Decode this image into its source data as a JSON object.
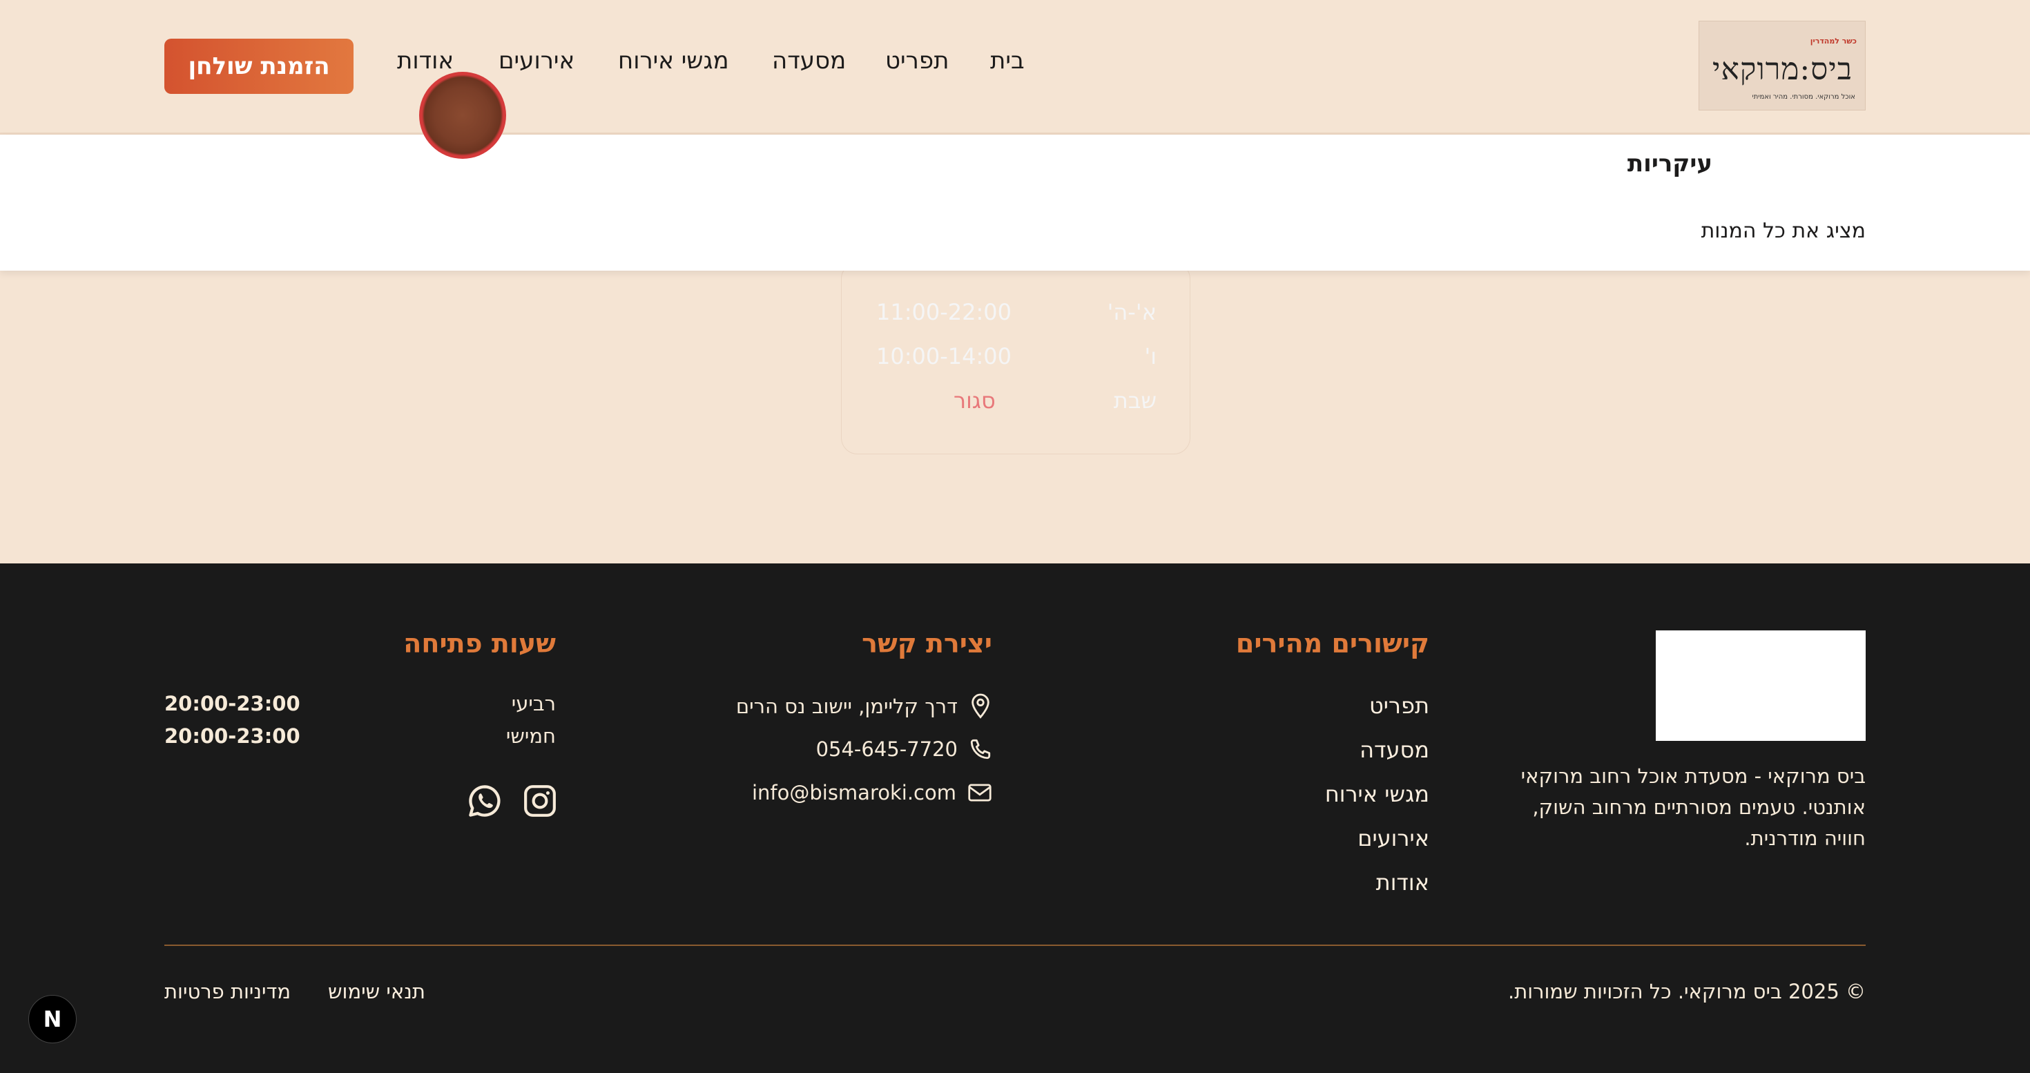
{
  "brand": {
    "logo_tag": "כשר למהדרין",
    "logo_name": "ביס:מרוקאי",
    "logo_sub": "אוכל מרוקאי. מסורתי. מהיר ואמיתי"
  },
  "nav": {
    "items": [
      "בית",
      "תפריט",
      "מסעדה",
      "מגשי אירוח",
      "אירועים",
      "אודות"
    ],
    "cta": "הזמנת שולחן"
  },
  "dropdown": {
    "title": "עיקריות",
    "show_all": "מציג את כל המנות"
  },
  "hours_card": {
    "rows": [
      {
        "day": "א'-ה'",
        "time": "11:00-22:00"
      },
      {
        "day": "ו'",
        "time": "10:00-14:00"
      },
      {
        "day": "שבת",
        "time": "סגור"
      }
    ]
  },
  "footer": {
    "about": "ביס מרוקאי - מסעדת אוכל רחוב מרוקאי אותנטי. טעמים מסורתיים מרחוב השוק, חוויה מודרנית.",
    "quick_links": {
      "title": "קישורים מהירים",
      "items": [
        "תפריט",
        "מסעדה",
        "מגשי אירוח",
        "אירועים",
        "אודות"
      ]
    },
    "contact": {
      "title": "יצירת קשר",
      "address": "דרך קליימן, יישוב נס הרים",
      "phone": "054-645-7720",
      "email": "info@bismaroki.com"
    },
    "hours": {
      "title": "שעות פתיחה",
      "rows": [
        {
          "day": "רביעי",
          "time": "20:00-23:00"
        },
        {
          "day": "חמישי",
          "time": "20:00-23:00"
        }
      ]
    },
    "copyright": "© 2025 ביס מרוקאי. כל הזכויות שמורות.",
    "terms": "תנאי שימוש",
    "privacy": "מדיניות פרטיות"
  },
  "next_badge": "N",
  "colors": {
    "accent": "#e07a3a",
    "closed": "#e8787a",
    "footer_bg": "#1a1a1a",
    "page_bg": "#f5e4d3"
  }
}
